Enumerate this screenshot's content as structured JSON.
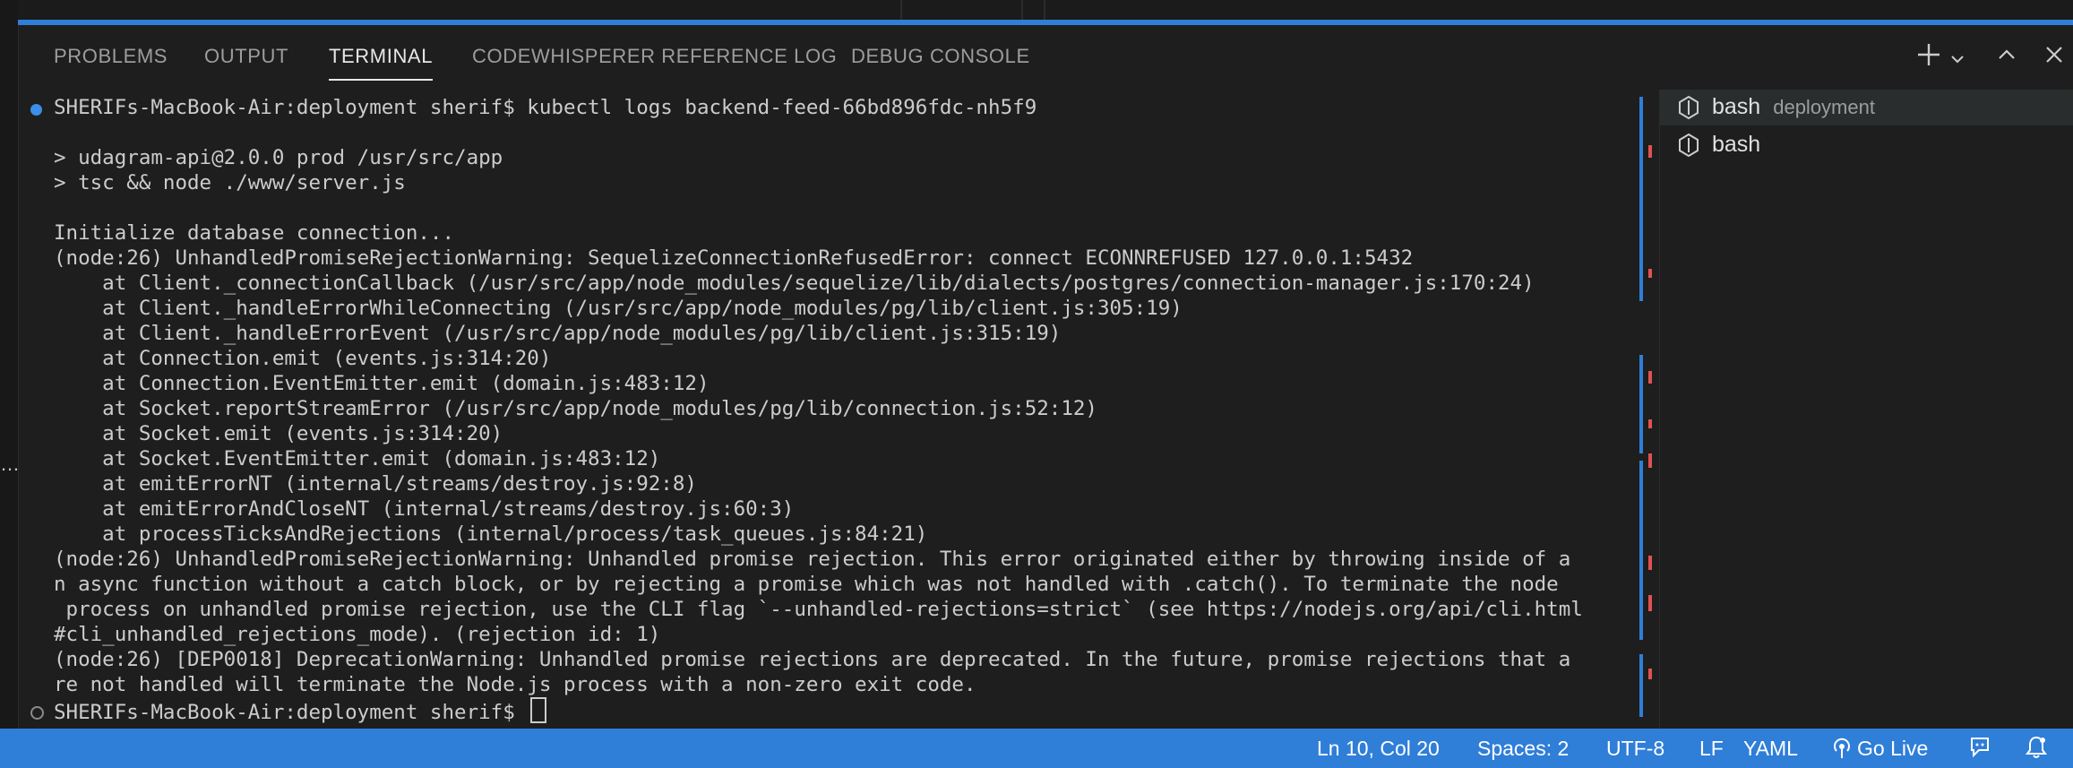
{
  "panel": {
    "tabs": [
      {
        "label": "PROBLEMS"
      },
      {
        "label": "OUTPUT"
      },
      {
        "label": "TERMINAL",
        "active": true
      },
      {
        "label": "CODEWHISPERER REFERENCE LOG"
      },
      {
        "label": "DEBUG CONSOLE"
      }
    ],
    "actions": [
      "new-terminal-icon",
      "chevron-down-icon",
      "maximize-panel-icon",
      "close-panel-icon"
    ]
  },
  "terminal": {
    "lines": [
      "SHERIFs-MacBook-Air:deployment sherif$ kubectl logs backend-feed-66bd896fdc-nh5f9",
      "",
      "> udagram-api@2.0.0 prod /usr/src/app",
      "> tsc && node ./www/server.js",
      "",
      "Initialize database connection...",
      "(node:26) UnhandledPromiseRejectionWarning: SequelizeConnectionRefusedError: connect ECONNREFUSED 127.0.0.1:5432",
      "    at Client._connectionCallback (/usr/src/app/node_modules/sequelize/lib/dialects/postgres/connection-manager.js:170:24)",
      "    at Client._handleErrorWhileConnecting (/usr/src/app/node_modules/pg/lib/client.js:305:19)",
      "    at Client._handleErrorEvent (/usr/src/app/node_modules/pg/lib/client.js:315:19)",
      "    at Connection.emit (events.js:314:20)",
      "    at Connection.EventEmitter.emit (domain.js:483:12)",
      "    at Socket.reportStreamError (/usr/src/app/node_modules/pg/lib/connection.js:52:12)",
      "    at Socket.emit (events.js:314:20)",
      "    at Socket.EventEmitter.emit (domain.js:483:12)",
      "    at emitErrorNT (internal/streams/destroy.js:92:8)",
      "    at emitErrorAndCloseNT (internal/streams/destroy.js:60:3)",
      "    at processTicksAndRejections (internal/process/task_queues.js:84:21)",
      "(node:26) UnhandledPromiseRejectionWarning: Unhandled promise rejection. This error originated either by throwing inside of a",
      "n async function without a catch block, or by rejecting a promise which was not handled with .catch(). To terminate the node",
      " process on unhandled promise rejection, use the CLI flag `--unhandled-rejections=strict` (see https://nodejs.org/api/cli.html",
      "#cli_unhandled_rejections_mode). (rejection id: 1)",
      "(node:26) [DEP0018] DeprecationWarning: Unhandled promise rejections are deprecated. In the future, promise rejections that a",
      "re not handled will terminate the Node.js process with a non-zero exit code.",
      "SHERIFs-MacBook-Air:deployment sherif$ "
    ]
  },
  "sessions": [
    {
      "name": "bash",
      "cwd": "deployment",
      "active": true
    },
    {
      "name": "bash",
      "cwd": "",
      "active": false
    }
  ],
  "statusbar": {
    "cursor": "Ln 10, Col 20",
    "indent": "Spaces: 2",
    "encoding": "UTF-8",
    "eol": "LF",
    "language": "YAML",
    "golive": "Go Live"
  },
  "colors": {
    "accent": "#2f7ed8",
    "marker_blue": "#2f7ed8",
    "marker_red": "#e05252",
    "background": "#1e1e1e"
  }
}
